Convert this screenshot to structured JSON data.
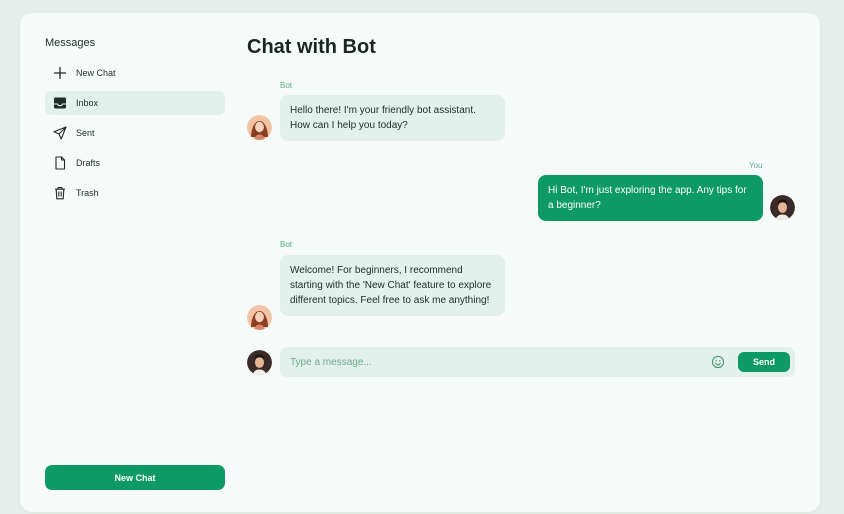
{
  "sidebar": {
    "title": "Messages",
    "items": [
      {
        "label": "New Chat",
        "icon": "plus-icon"
      },
      {
        "label": "Inbox",
        "icon": "inbox-icon"
      },
      {
        "label": "Sent",
        "icon": "send-icon"
      },
      {
        "label": "Drafts",
        "icon": "file-icon"
      },
      {
        "label": "Trash",
        "icon": "trash-icon"
      }
    ],
    "new_chat_button": "New Chat"
  },
  "main": {
    "title": "Chat with Bot",
    "messages": [
      {
        "sender": "Bot",
        "text": "Hello there! I'm your friendly bot assistant. How can I help you today?"
      },
      {
        "sender": "You",
        "text": "Hi Bot, I'm just exploring the app. Any tips for a beginner?"
      },
      {
        "sender": "Bot",
        "text": "Welcome! For beginners, I recommend starting with the 'New Chat' feature to explore different topics. Feel free to ask me anything!"
      }
    ],
    "composer": {
      "placeholder": "Type a message...",
      "send_label": "Send"
    }
  },
  "colors": {
    "accent": "#0e9a66",
    "bubble_bot": "#e3f1ec",
    "sender_label": "#5aa987"
  }
}
